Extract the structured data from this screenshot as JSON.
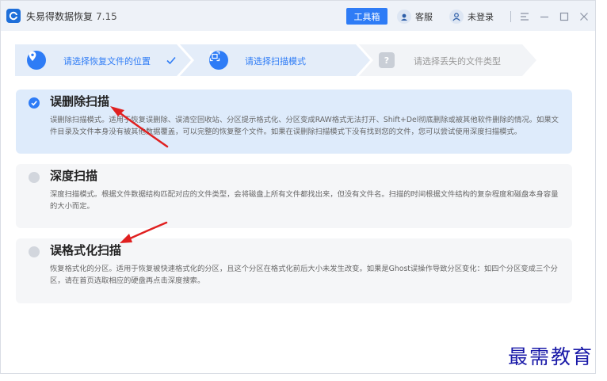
{
  "app": {
    "title": "失易得数据恢复",
    "version": "7.15"
  },
  "header": {
    "toolbox_label": "工具箱",
    "service_label": "客服",
    "login_label": "未登录"
  },
  "steps": [
    {
      "label": "请选择恢复文件的位置",
      "state": "done"
    },
    {
      "label": "请选择扫描模式",
      "state": "current"
    },
    {
      "label": "请选择丢失的文件类型",
      "state": "pending",
      "icon_text": "?"
    }
  ],
  "options": [
    {
      "title": "误删除扫描",
      "selected": true,
      "desc": "误删除扫描模式。适用于恢复误删除、误清空回收站、分区提示格式化、分区变成RAW格式无法打开、Shift+Del彻底删除或被其他软件删除的情况。如果文件目录及文件本身没有被其他数据覆盖，可以完整的恢复整个文件。如果在误删除扫描模式下没有找到您的文件，您可以尝试使用深度扫描模式。"
    },
    {
      "title": "深度扫描",
      "selected": false,
      "desc": "深度扫描模式。根据文件数据结构匹配对应的文件类型，会将磁盘上所有文件都找出来，但没有文件名。扫描的时间根据文件结构的复杂程度和磁盘本身容量的大小而定。"
    },
    {
      "title": "误格式化扫描",
      "selected": false,
      "desc": "恢复格式化的分区。适用于恢复被快速格式化的分区，且这个分区在格式化前后大小未发生改变。如果是Ghost误操作导致分区变化：如四个分区变成三个分区，请在首页选取相应的硬盘再点击深度搜索。"
    }
  ],
  "watermark": "最需教育",
  "colors": {
    "accent": "#2e7cf6",
    "selected_bg": "#deebfb",
    "option_bg": "#f5f6f8",
    "arrow": "#e02020"
  }
}
